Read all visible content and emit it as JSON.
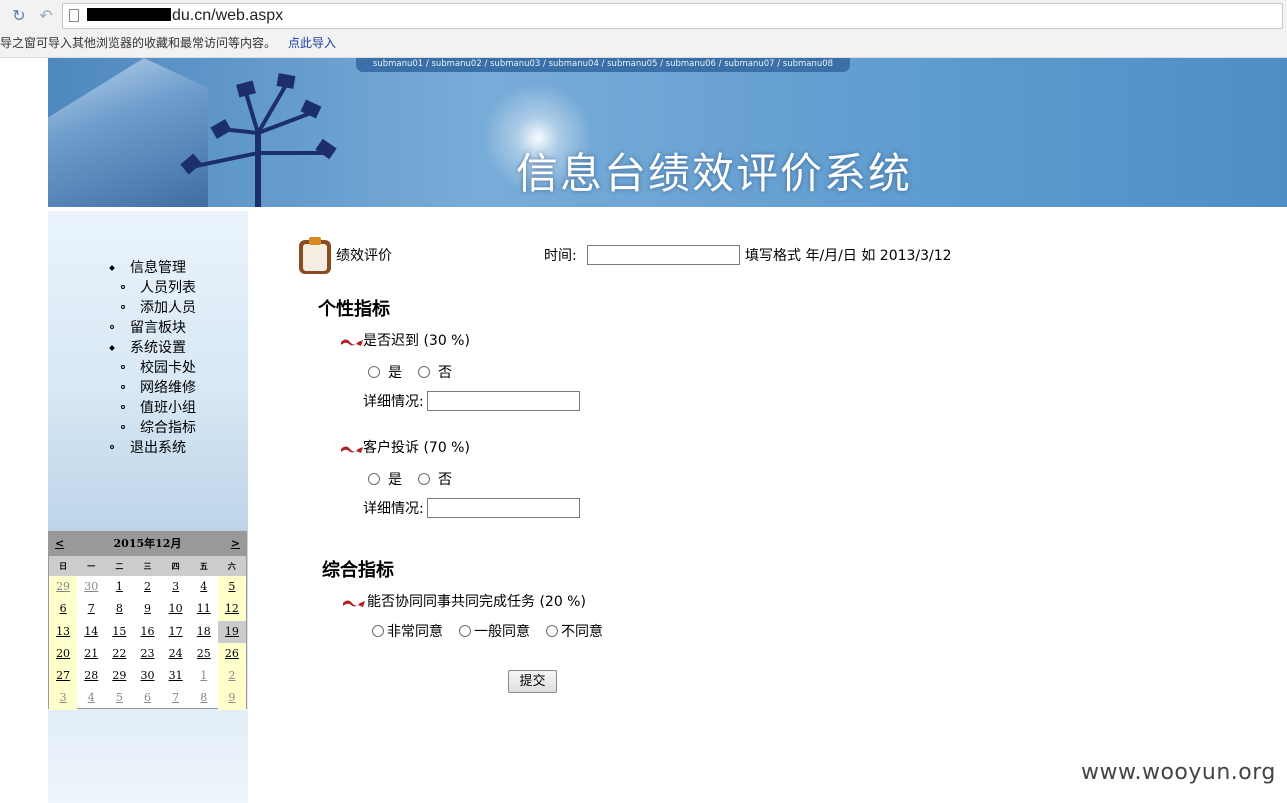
{
  "browser": {
    "url_suffix": "du.cn/web.aspx",
    "bookmark_notice": "导之窗可导入其他浏览器的收藏和最常访问等内容。",
    "bookmark_link": "点此导入"
  },
  "banner": {
    "submenu": "submanu01 / submanu02 / submanu03 / submanu04 / submanu05 / submanu06 / submanu07 / submanu08",
    "title": "信息台绩效评价系统"
  },
  "sidebar": {
    "items": [
      {
        "label": "信息管理",
        "level": 1,
        "bullet": "diamond"
      },
      {
        "label": "人员列表",
        "level": 2,
        "bullet": "circle"
      },
      {
        "label": "添加人员",
        "level": 2,
        "bullet": "circle"
      },
      {
        "label": "留言板块",
        "level": 1,
        "bullet": "circle"
      },
      {
        "label": "系统设置",
        "level": 1,
        "bullet": "diamond"
      },
      {
        "label": "校园卡处",
        "level": 2,
        "bullet": "circle"
      },
      {
        "label": "网络维修",
        "level": 2,
        "bullet": "circle"
      },
      {
        "label": "值班小组",
        "level": 2,
        "bullet": "circle"
      },
      {
        "label": "综合指标",
        "level": 2,
        "bullet": "circle"
      },
      {
        "label": "退出系统",
        "level": 1,
        "bullet": "circle"
      }
    ]
  },
  "calendar": {
    "month_label": "2015年12月",
    "prev": "<",
    "next": ">",
    "weekdays": [
      "日",
      "一",
      "二",
      "三",
      "四",
      "五",
      "六"
    ],
    "today": "19",
    "weeks": [
      [
        "29",
        "30",
        "1",
        "2",
        "3",
        "4",
        "5"
      ],
      [
        "6",
        "7",
        "8",
        "9",
        "10",
        "11",
        "12"
      ],
      [
        "13",
        "14",
        "15",
        "16",
        "17",
        "18",
        "19"
      ],
      [
        "20",
        "21",
        "22",
        "23",
        "24",
        "25",
        "26"
      ],
      [
        "27",
        "28",
        "29",
        "30",
        "31",
        "1",
        "2"
      ],
      [
        "3",
        "4",
        "5",
        "6",
        "7",
        "8",
        "9"
      ]
    ],
    "other_month": [
      [
        0,
        0
      ],
      [
        0,
        1
      ],
      [
        4,
        5
      ],
      [
        4,
        6
      ],
      [
        5,
        0
      ],
      [
        5,
        1
      ],
      [
        5,
        2
      ],
      [
        5,
        3
      ],
      [
        5,
        4
      ],
      [
        5,
        5
      ],
      [
        5,
        6
      ]
    ]
  },
  "form": {
    "title": "绩效评价",
    "time_label": "时间:",
    "time_value": "",
    "time_hint": "填写格式 年/月/日 如 2013/3/12",
    "section1": "个性指标",
    "q1": "是否迟到 (30 %)",
    "q1_yes": "是",
    "q1_no": "否",
    "detail_label": "详细情况:",
    "q2": "客户投诉 (70 %)",
    "q2_yes": "是",
    "q2_no": "否",
    "detail_label2": "详细情况:",
    "section2": "综合指标",
    "q3": "能否协同同事共同完成任务 (20 %)",
    "q3_opt1": "非常同意",
    "q3_opt2": "一般同意",
    "q3_opt3": "不同意",
    "submit": "提交"
  },
  "watermark": "www.wooyun.org"
}
